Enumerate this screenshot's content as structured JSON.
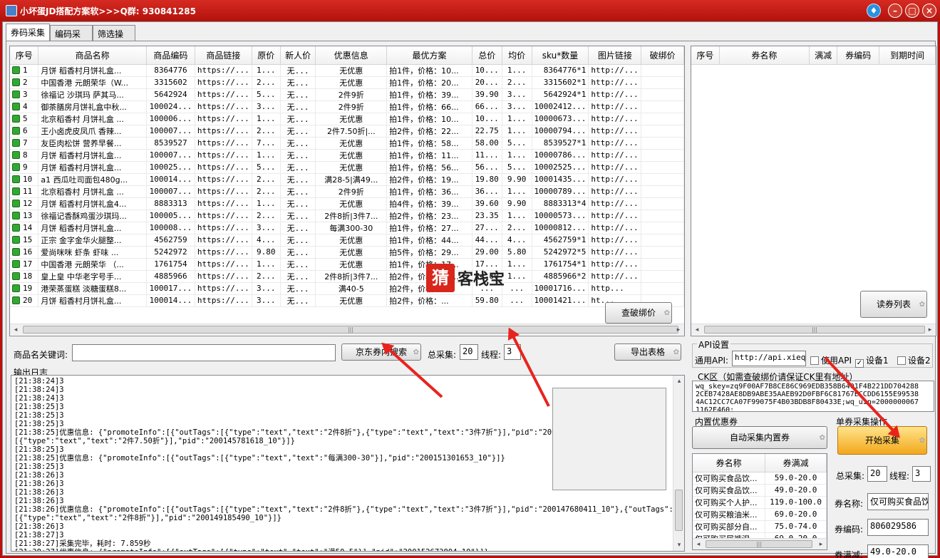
{
  "window": {
    "title": "小坏蛋JD搭配方案软>>>Q群: 930841285"
  },
  "tabs": [
    "券码采集",
    "编码采集",
    "筛选操作"
  ],
  "product_table": {
    "columns": [
      "序号",
      "商品名称",
      "商品编码",
      "商品链接",
      "原价",
      "新人价",
      "优惠信息",
      "最优方案",
      "总价",
      "均价",
      "sku*数量",
      "图片链接",
      "破绑价"
    ],
    "rows": [
      [
        "1",
        "月饼 稻香村月饼礼盒...",
        "8364776",
        "https://...",
        "1...",
        "无...",
        "无优惠",
        "拍1件，价格：10...",
        "10...",
        "1...",
        "8364776*1",
        "http://...",
        ""
      ],
      [
        "2",
        "中国香港 元朗荣华（W...",
        "3315602",
        "https://...",
        "2...",
        "无...",
        "无优惠",
        "拍1件，价格：20...",
        "20...",
        "2...",
        "3315602*1",
        "http://...",
        ""
      ],
      [
        "3",
        "徐福记 沙琪玛 萨其马...",
        "5642924",
        "https://...",
        "5...",
        "无...",
        "2件9折",
        "拍1件，价格：39...",
        "39.90",
        "3...",
        "5642924*1",
        "http://...",
        ""
      ],
      [
        "4",
        "御茶膳房月饼礼盒中秋...",
        "100024...",
        "https://...",
        "3...",
        "无...",
        "2件9折",
        "拍1件，价格：66...",
        "66...",
        "3...",
        "10002412...",
        "http://...",
        ""
      ],
      [
        "5",
        "北京稻香村 月饼礼盒 ...",
        "100006...",
        "https://...",
        "1...",
        "无...",
        "无优惠",
        "拍1件，价格：10...",
        "10...",
        "1...",
        "10000673...",
        "http://...",
        ""
      ],
      [
        "6",
        "王小卤虎皮凤爪 香辣...",
        "100007...",
        "https://...",
        "2...",
        "无...",
        "2件7.50折|...",
        "拍2件，价格：22...",
        "22.75",
        "1...",
        "10000794...",
        "http://...",
        ""
      ],
      [
        "7",
        "友臣肉松饼 营养早餐...",
        "8539527",
        "https://...",
        "7...",
        "无...",
        "无优惠",
        "拍1件，价格：58...",
        "58.00",
        "5...",
        "8539527*1",
        "http://...",
        ""
      ],
      [
        "8",
        "月饼 稻香村月饼礼盒...",
        "100007...",
        "https://...",
        "1...",
        "无...",
        "无优惠",
        "拍1件，价格：11...",
        "11...",
        "1...",
        "10000786...",
        "http://...",
        ""
      ],
      [
        "9",
        "月饼 稻香村月饼礼盒...",
        "100025...",
        "https://...",
        "5...",
        "无...",
        "无优惠",
        "拍1件，价格：56...",
        "56...",
        "5...",
        "10002525...",
        "http://...",
        ""
      ],
      [
        "10",
        "a1 西瓜吐司面包480g...",
        "100014...",
        "https://...",
        "2...",
        "无...",
        "满28-5|满49...",
        "拍2件，价格：19...",
        "19.80",
        "9.90",
        "10001435...",
        "http://...",
        ""
      ],
      [
        "11",
        "北京稻香村 月饼礼盒 ...",
        "100007...",
        "https://...",
        "2...",
        "无...",
        "2件9折",
        "拍1件，价格：36...",
        "36...",
        "1...",
        "10000789...",
        "http://...",
        ""
      ],
      [
        "12",
        "月饼 稻香村月饼礼盒4...",
        "8883313",
        "https://...",
        "1...",
        "无...",
        "无优惠",
        "拍4件，价格：39...",
        "39.60",
        "9.90",
        "8883313*4",
        "http://...",
        ""
      ],
      [
        "13",
        "徐福记香酥鸡蛋沙琪玛...",
        "100005...",
        "https://...",
        "2...",
        "无...",
        "2件8折|3件7...",
        "拍2件，价格：23...",
        "23.35",
        "1...",
        "10000573...",
        "http://...",
        ""
      ],
      [
        "14",
        "月饼 稻香村月饼礼盒...",
        "100008...",
        "https://...",
        "3...",
        "无...",
        "每满300-30",
        "拍1件，价格：27...",
        "27...",
        "2...",
        "10000812...",
        "http://...",
        ""
      ],
      [
        "15",
        "正宗 金字金华火腿整...",
        "4562759",
        "https://...",
        "4...",
        "无...",
        "无优惠",
        "拍1件，价格：44...",
        "44...",
        "4...",
        "4562759*1",
        "http://...",
        ""
      ],
      [
        "16",
        "爱尚咪咪 虾条 虾味 ...",
        "5242972",
        "https://...",
        "9.80",
        "无...",
        "无优惠",
        "拍5件，价格：29...",
        "29.00",
        "5.80",
        "5242972*5",
        "http://...",
        ""
      ],
      [
        "17",
        "中国香港 元朗荣华 （...",
        "1761754",
        "https://...",
        "1...",
        "无...",
        "无优惠",
        "拍1件，价格：17...",
        "17...",
        "1...",
        "1761754*1",
        "http://...",
        ""
      ],
      [
        "18",
        "皇上皇 中华老字号手...",
        "4885966",
        "https://...",
        "2...",
        "无...",
        "2件8折|3件7...",
        "拍2件，价格：24...",
        "24.80",
        "1...",
        "4885966*2",
        "http://...",
        ""
      ],
      [
        "19",
        "港荣蒸蛋糕 淡糖蛋糕8...",
        "100017...",
        "https://...",
        "3...",
        "无...",
        "满40-5",
        "拍2件，价格：...",
        "...",
        "...",
        "10001716...",
        "http...",
        ""
      ],
      [
        "20",
        "月饼 稻香村月饼礼盒...",
        "100014...",
        "https://...",
        "3...",
        "无...",
        "无优惠",
        "拍2件，价格：...",
        "59.80",
        "...",
        "10001421...",
        "ht...",
        ""
      ]
    ]
  },
  "coupon_table": {
    "columns": [
      "序号",
      "券名称",
      "满减",
      "券编码",
      "到期时间"
    ]
  },
  "buttons": {
    "check_price": "查破绑价",
    "read_coupons": "读券列表",
    "jd_search": "京东券内搜索",
    "export": "导出表格",
    "auto_collect": "自动采集内置券",
    "start_collect": "开始采集"
  },
  "search": {
    "label": "商品名关键词:",
    "value": "",
    "total_label": "总采集:",
    "total_value": "20",
    "thread_label": "线程:",
    "thread_value": "3"
  },
  "api": {
    "group_title": "API设置",
    "general_label": "通用API:",
    "general_value": "http://api.xiequ...",
    "use_api_label": "使用API",
    "device1_label": "设备1",
    "device2_label": "设备2"
  },
  "ck": {
    "group_title": "CK区（如需查破绑价请保证CK里有地址）",
    "lines": [
      "wq_skey=zq9F00AF7B8CE86C969EDB358B6401F4B221DD704288",
      "2CEB7428AE8DB9ABE35AAEB92D0FBF6C81767ECCDD6155E99538",
      "4AC12CC7CA07F99075F4B03BDB8F80433E;wq_uin=2000000067",
      "1162E460;"
    ]
  },
  "builtin_coupons": {
    "group_title": "内置优惠券",
    "columns": [
      "券名称",
      "券满减"
    ],
    "rows": [
      [
        "仅可购买食品饮...",
        "59.0-20.0"
      ],
      [
        "仅可购买食品饮...",
        "49.0-20.0"
      ],
      [
        "仅可购买个人护...",
        "119.0-100.0"
      ],
      [
        "仅可购买粮油米...",
        "69.0-20.0"
      ],
      [
        "仅可购买部分自...",
        "75.0-74.0"
      ],
      [
        "仅可购买尿裤湿...",
        "69.0-20.0"
      ]
    ]
  },
  "single_coupon": {
    "group_title": "单券采集操作",
    "total_label": "总采集:",
    "total_value": "20",
    "thread_label": "线程:",
    "thread_value": "3",
    "name_label": "券名称:",
    "name_value": "仅可购买食品饮",
    "code_label": "券编码:",
    "code_value": "806029586",
    "discount_label": "券满减:",
    "discount_value": "49.0-20.0"
  },
  "log": {
    "title": "输出日志",
    "lines": [
      "[21:38:24]3",
      "[21:38:24]3",
      "[21:38:24]3",
      "[21:38:25]3",
      "[21:38:25]3",
      "[21:38:25]3",
      "[21:38:25]优惠信息: {\"promoteInfo\":[{\"outTags\":[{\"type\":\"text\",\"text\":\"2件8折\"},{\"type\":\"text\",\"text\":\"3件7折\"}],\"pid\":\"200147",
      "[{\"type\":\"text\",\"text\":\"2件7.50折\"}],\"pid\":\"200145781618_10\"}]}",
      "[21:38:25]3",
      "[21:38:25]优惠信息: {\"promoteInfo\":[{\"outTags\":[{\"type\":\"text\",\"text\":\"每满300-30\"}],\"pid\":\"200151301653_10\"}]}",
      "[21:38:25]3",
      "[21:38:26]3",
      "[21:38:26]3",
      "[21:38:26]3",
      "[21:38:26]3",
      "[21:38:26]优惠信息: {\"promoteInfo\":[{\"outTags\":[{\"type\":\"text\",\"text\":\"2件8折\"},{\"type\":\"text\",\"text\":\"3件7折\"}],\"pid\":\"200147680411_10\"},{\"outTags\":",
      "[{\"type\":\"text\",\"text\":\"2件8折\"}],\"pid\":\"200149185490_10\"}]}",
      "[21:38:26]3",
      "[21:38:27]3",
      "[21:38:27]采集完毕，耗时: 7.859秒",
      "[21:38:27]优惠信息: {\"promoteInfo\":[{\"outTags\":[{\"type\":\"text\",\"text\":\"满50-5\"}],\"pid\":\"200152673804_10\"}]}"
    ]
  },
  "watermark": {
    "text": "客栈宝"
  },
  "colors": {
    "titlebar": "#c41e16",
    "arrow": "#e8231e",
    "row_icon": "#31a831"
  }
}
